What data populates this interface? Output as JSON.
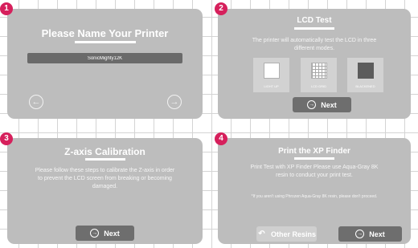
{
  "steps": [
    {
      "number": "1",
      "title": "Please Name Your Printer",
      "input_value": "SonicMighty12K",
      "prev_icon": "arrow-left-circle-icon",
      "next_icon": "arrow-right-circle-icon"
    },
    {
      "number": "2",
      "title": "LCD Test",
      "description": "The printer will automatically test the LCD in three different modes.",
      "modes": [
        {
          "label": "LIGHT UP",
          "icon": "white-square-icon"
        },
        {
          "label": "LCD GRID",
          "icon": "grid-icon"
        },
        {
          "label": "BLACKENED",
          "icon": "black-square-icon"
        }
      ],
      "button_label": "Next",
      "button_icon": "arrow-right-circle-icon"
    },
    {
      "number": "3",
      "title": "Z-axis Calibration",
      "description": "Please follow these steps to calibrate the Z-axis in order to prevent the LCD screen from breaking or becoming damaged.",
      "button_label": "Next",
      "button_icon": "arrow-right-circle-icon"
    },
    {
      "number": "4",
      "title": "Print the XP Finder",
      "description": "Print Test with XP Finder Please use Aqua-Gray 8K resin to conduct your print test.",
      "note": "*If you aren't using Phrozen Aqua-Gray 8K resin, please don't proceed.",
      "secondary_button_label": "Other Resins",
      "secondary_button_icon": "undo-arrow-icon",
      "button_label": "Next",
      "button_icon": "arrow-right-circle-icon"
    }
  ],
  "colors": {
    "background": "#ffffff",
    "panel": "#bdbdbd",
    "badge": "#d6205c",
    "button": "#6e6e6e",
    "secondary_button": "#cfcfcf",
    "input": "#6a6a6a"
  }
}
